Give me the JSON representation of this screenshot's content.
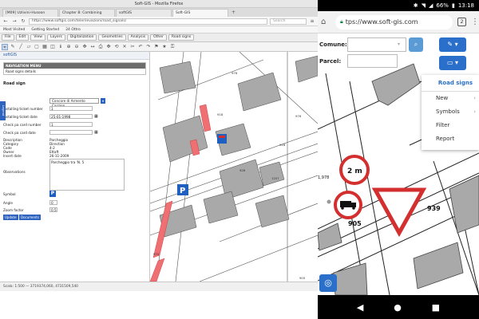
{
  "desktop": {
    "window_title": "Soft-GIS - Mozilla Firefox",
    "tabs": [
      {
        "label": "[M09] Uzlivini-Husoon"
      },
      {
        "label": "Chapter 8: Combining"
      },
      {
        "label": "softGIS"
      },
      {
        "label": "Soft-GIS"
      }
    ],
    "url": "https://www.softgis.com/telerilevazioni/road_signals/",
    "search_placeholder": "Search",
    "bookmarks": [
      "Most Visited",
      "Getting Started",
      "24 Ottro"
    ],
    "menu": [
      "File",
      "Edit",
      "View",
      "Layers",
      "Digitalization",
      "Geometries",
      "Analysis",
      "Other",
      "Road signs"
    ],
    "panel": {
      "title": "softGIS",
      "nav_title": "NAVIGATION MENU",
      "nav_text": "Road signs details",
      "section": "Road sign",
      "type_value": "Concore di Armento Cazzion",
      "fields": [
        {
          "label": "Installing ticket number",
          "value": "1"
        },
        {
          "label": "Installing ticket date",
          "value": "25-01-1998"
        },
        {
          "label": "Check pa card number",
          "value": "1"
        },
        {
          "label": "Check pa card date",
          "value": ""
        },
        {
          "label": "Description",
          "value": "Parcheggio"
        },
        {
          "label": "Category",
          "value": "Direction"
        },
        {
          "label": "Code",
          "value": "4-2"
        },
        {
          "label": "Owner",
          "value": "Ettaft"
        },
        {
          "label": "Insert date",
          "value": "26-11-2009"
        }
      ],
      "obs_label": "Observations",
      "obs_text": "Parcheggio tra 'N. 5",
      "symbol_label": "Symbol",
      "symbol_value": "P",
      "angle_label": "Angle",
      "angle_value": "0",
      "zoom_label": "Zoom factor",
      "zoom_value": "0.5",
      "side_tab": "Legend",
      "update_label": "Update",
      "documents_label": "Documents"
    },
    "status_bar": "Scala: 1:500  —  3719374,060, 4731509,540"
  },
  "phone": {
    "status": {
      "battery": "66%",
      "time": "13:18"
    },
    "url": "tps://www.soft-gis.com",
    "tab_count": "2",
    "comune_label": "Comune:",
    "parcel_label": "Parcel:",
    "menu": {
      "title": "Road signs",
      "items": [
        "New",
        "Symbols",
        "Filter",
        "Report"
      ]
    },
    "map_labels": [
      "2 m",
      "905",
      "939",
      "1,978"
    ]
  },
  "icons": {
    "back": "back-icon",
    "forward": "forward-icon",
    "reload": "reload-icon",
    "home": "home-icon",
    "lock": "lock-icon",
    "search": "search-icon",
    "pen": "pen-icon",
    "layers": "layers-icon",
    "locate": "locate-icon",
    "more": "more-icon"
  },
  "colors": {
    "accent": "#2a6fc9",
    "parking_sign": "#1f5fbf",
    "no_through": "#d32f2f",
    "building": "#a9a9a9",
    "red_parcel": "#ef6f73"
  }
}
